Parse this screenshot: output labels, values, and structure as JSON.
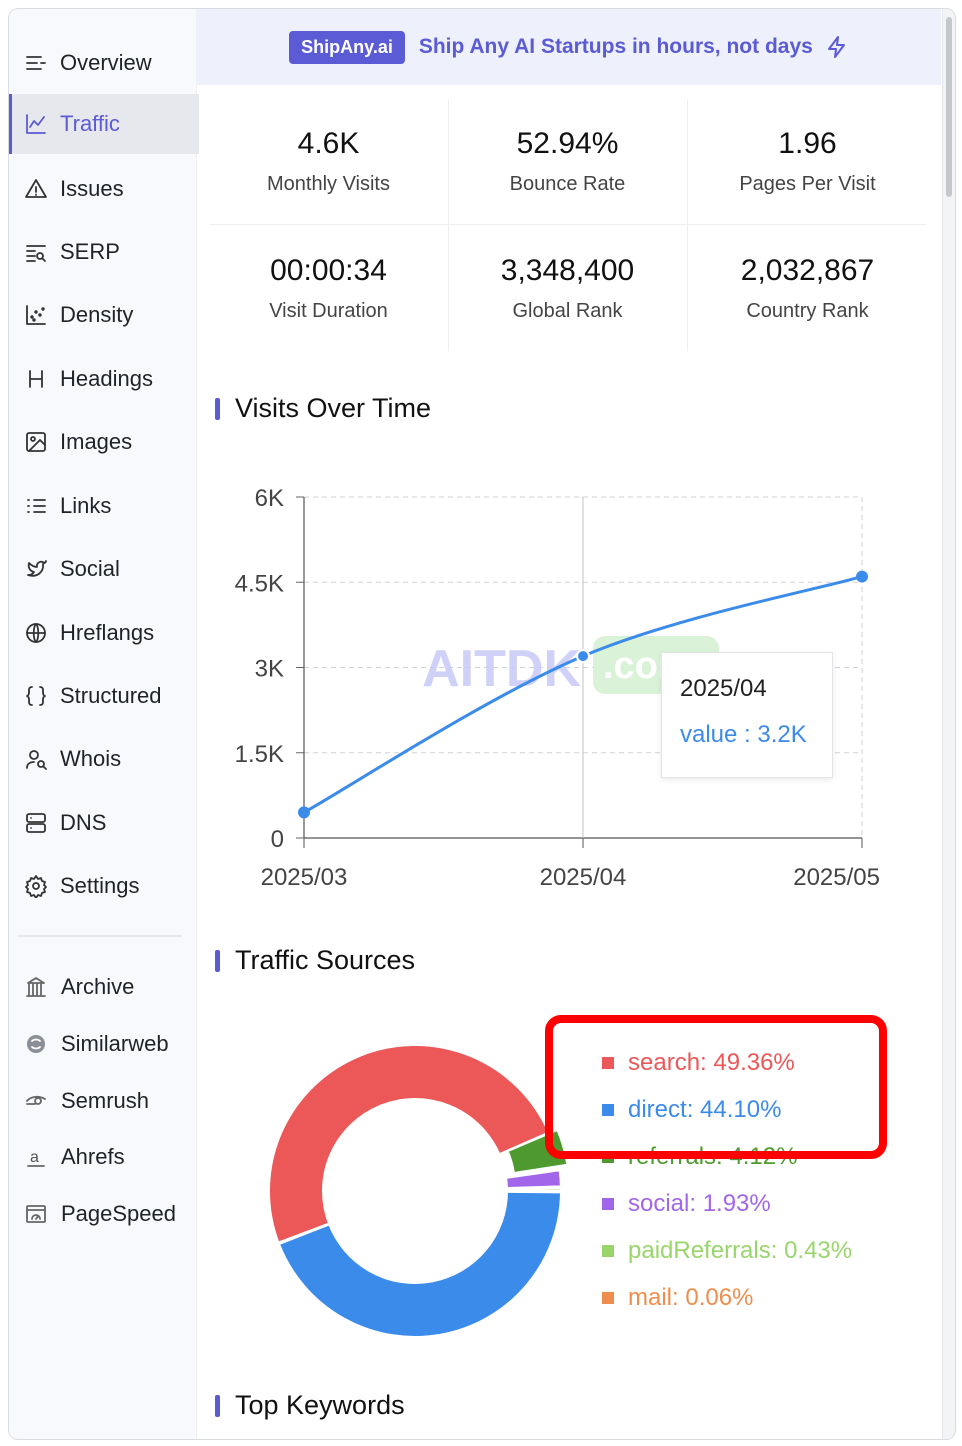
{
  "sidebar": {
    "items": [
      {
        "label": "Overview",
        "icon": "overview-icon"
      },
      {
        "label": "Traffic",
        "icon": "traffic-icon"
      },
      {
        "label": "Issues",
        "icon": "warning-icon"
      },
      {
        "label": "SERP",
        "icon": "serp-icon"
      },
      {
        "label": "Density",
        "icon": "density-icon"
      },
      {
        "label": "Headings",
        "icon": "heading-icon"
      },
      {
        "label": "Images",
        "icon": "image-icon"
      },
      {
        "label": "Links",
        "icon": "links-icon"
      },
      {
        "label": "Social",
        "icon": "twitter-icon"
      },
      {
        "label": "Hreflangs",
        "icon": "globe-icon"
      },
      {
        "label": "Structured",
        "icon": "braces-icon"
      },
      {
        "label": "Whois",
        "icon": "user-search-icon"
      },
      {
        "label": "DNS",
        "icon": "server-icon"
      },
      {
        "label": "Settings",
        "icon": "gear-icon"
      }
    ],
    "active": "Traffic",
    "external": [
      {
        "label": "Archive",
        "icon": "archive-icon"
      },
      {
        "label": "Similarweb",
        "icon": "similarweb-icon"
      },
      {
        "label": "Semrush",
        "icon": "semrush-icon"
      },
      {
        "label": "Ahrefs",
        "icon": "ahrefs-icon"
      },
      {
        "label": "PageSpeed",
        "icon": "pagespeed-icon"
      }
    ]
  },
  "banner": {
    "badge": "ShipAny.ai",
    "text": "Ship Any AI Startups in hours, not days",
    "accent": "#5b5bd6"
  },
  "stats": [
    {
      "value": "4.6K",
      "label": "Monthly Visits"
    },
    {
      "value": "52.94%",
      "label": "Bounce Rate"
    },
    {
      "value": "1.96",
      "label": "Pages Per Visit"
    },
    {
      "value": "00:00:34",
      "label": "Visit Duration"
    },
    {
      "value": "3,348,400",
      "label": "Global Rank"
    },
    {
      "value": "2,032,867",
      "label": "Country Rank"
    }
  ],
  "visits_section": {
    "title": "Visits Over Time"
  },
  "watermark": {
    "main": "AITDK",
    "suffix": ".com"
  },
  "tooltip": {
    "title": "2025/04",
    "value_text": "value : 3.2K"
  },
  "sources_section": {
    "title": "Traffic Sources"
  },
  "keywords_section": {
    "title": "Top Keywords"
  },
  "legend_labels": [
    "search: 49.36%",
    "direct: 44.10%",
    "referrals: 4.12%",
    "social: 1.93%",
    "paidReferrals: 0.43%",
    "mail: 0.06%"
  ],
  "chart_data": [
    {
      "type": "line",
      "x": [
        "2025/03",
        "2025/04",
        "2025/05"
      ],
      "series": [
        {
          "values": [
            450,
            3200,
            4600
          ]
        }
      ],
      "yticks": [
        "0",
        "1.5K",
        "3K",
        "4.5K",
        "6K"
      ],
      "ylim": [
        0,
        6000
      ],
      "grid": true,
      "line_color": "#3b8beb"
    },
    {
      "type": "pie",
      "donut": true,
      "categories": [
        "search",
        "direct",
        "referrals",
        "social",
        "paidReferrals",
        "mail"
      ],
      "values": [
        49.36,
        44.1,
        4.12,
        1.93,
        0.43,
        0.06
      ],
      "colors": [
        "#ec5758",
        "#3b8beb",
        "#4f9a2f",
        "#a166ea",
        "#99d56b",
        "#ef8e4c"
      ],
      "legend": "right"
    }
  ]
}
